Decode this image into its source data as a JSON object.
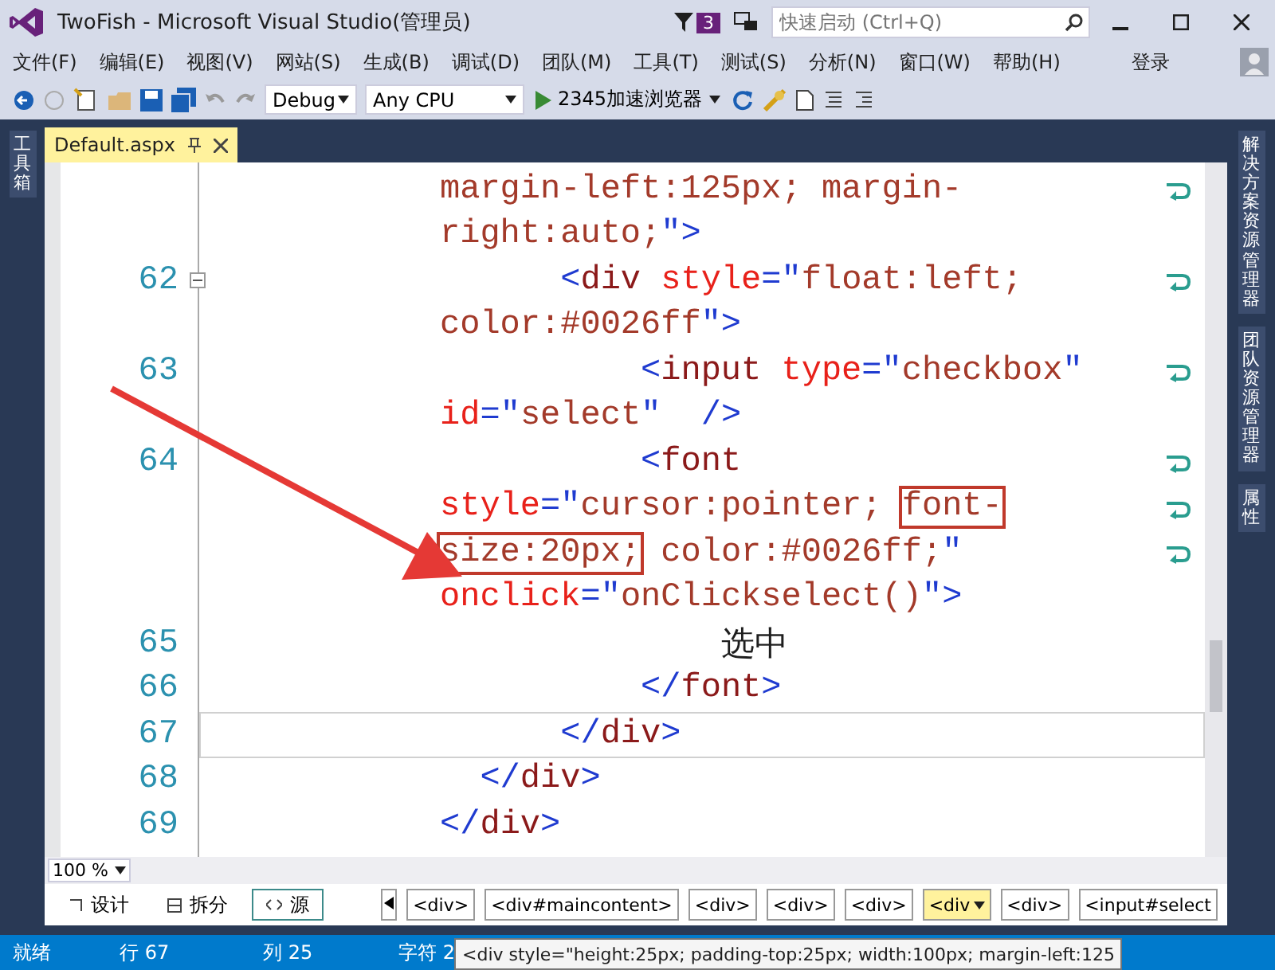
{
  "window": {
    "title": "TwoFish - Microsoft Visual Studio(管理员)",
    "notification_count": "3",
    "quick_launch": {
      "placeholder": "快速启动 (Ctrl+Q)"
    }
  },
  "menu": [
    "文件(F)",
    "编辑(E)",
    "视图(V)",
    "网站(S)",
    "生成(B)",
    "调试(D)",
    "团队(M)",
    "工具(T)",
    "测试(S)",
    "分析(N)",
    "窗口(W)",
    "帮助(H)"
  ],
  "sign_in": "登录",
  "toolbar": {
    "configuration": "Debug",
    "platform": "Any CPU",
    "run_target": "2345加速浏览器"
  },
  "left_panels": [
    "工具箱"
  ],
  "right_panels": [
    "解决方案资源管理器",
    "团队资源管理器",
    "属性"
  ],
  "document_tab": {
    "title": "Default.aspx",
    "selected": true
  },
  "code_lines": [
    {
      "segments": [
        {
          "kind": "value",
          "text": "margin-left:125px; margin-",
          "boxed": false
        }
      ],
      "wrapped": true,
      "current": false,
      "foldable": false
    },
    {
      "segments": [
        {
          "kind": "value",
          "text": "right:auto;",
          "boxed": false
        },
        {
          "kind": "punct",
          "text": "\">",
          "boxed": false
        }
      ],
      "wrapped": false,
      "current": false,
      "foldable": false
    },
    {
      "number": "62",
      "segments": [
        {
          "kind": "punct",
          "text": "      <",
          "boxed": false
        },
        {
          "kind": "tag",
          "text": "div",
          "boxed": false
        },
        {
          "kind": "attr",
          "text": " style",
          "boxed": false
        },
        {
          "kind": "punct",
          "text": "=\"",
          "boxed": false
        },
        {
          "kind": "value",
          "text": "float:left;",
          "boxed": false
        }
      ],
      "wrapped": true,
      "current": false,
      "foldable": true
    },
    {
      "segments": [
        {
          "kind": "value",
          "text": "color:#0026ff",
          "boxed": false
        },
        {
          "kind": "punct",
          "text": "\">",
          "boxed": false
        }
      ],
      "wrapped": false,
      "current": false,
      "foldable": false
    },
    {
      "number": "63",
      "segments": [
        {
          "kind": "punct",
          "text": "          <",
          "boxed": false
        },
        {
          "kind": "tag",
          "text": "input",
          "boxed": false
        },
        {
          "kind": "attr",
          "text": " type",
          "boxed": false
        },
        {
          "kind": "punct",
          "text": "=\"",
          "boxed": false
        },
        {
          "kind": "value",
          "text": "checkbox",
          "boxed": false
        },
        {
          "kind": "punct",
          "text": "\"",
          "boxed": false
        }
      ],
      "wrapped": true,
      "current": false,
      "foldable": false
    },
    {
      "segments": [
        {
          "kind": "attr",
          "text": "id",
          "boxed": false
        },
        {
          "kind": "punct",
          "text": "=\"",
          "boxed": false
        },
        {
          "kind": "value",
          "text": "select",
          "boxed": false
        },
        {
          "kind": "punct",
          "text": "\"  />",
          "boxed": false
        }
      ],
      "wrapped": false,
      "current": false,
      "foldable": false
    },
    {
      "number": "64",
      "segments": [
        {
          "kind": "punct",
          "text": "          <",
          "boxed": false
        },
        {
          "kind": "tag",
          "text": "font",
          "boxed": false
        }
      ],
      "wrapped": true,
      "current": false,
      "foldable": false
    },
    {
      "segments": [
        {
          "kind": "attr",
          "text": "style",
          "boxed": false
        },
        {
          "kind": "punct",
          "text": "=\"",
          "boxed": false
        },
        {
          "kind": "value",
          "text": "cursor:pointer; ",
          "boxed": false
        },
        {
          "kind": "value",
          "text": "font-",
          "boxed": true
        }
      ],
      "wrapped": true,
      "current": false,
      "foldable": false
    },
    {
      "segments": [
        {
          "kind": "value",
          "text": "size:20px;",
          "boxed": true
        },
        {
          "kind": "value",
          "text": " color:#0026ff;",
          "boxed": false
        },
        {
          "kind": "punct",
          "text": "\"",
          "boxed": false
        }
      ],
      "wrapped": true,
      "current": false,
      "foldable": false
    },
    {
      "segments": [
        {
          "kind": "attr",
          "text": "onclick",
          "boxed": false
        },
        {
          "kind": "punct",
          "text": "=\"",
          "boxed": false
        },
        {
          "kind": "value",
          "text": "onClickselect()",
          "boxed": false
        },
        {
          "kind": "punct",
          "text": "\">",
          "boxed": false
        }
      ],
      "wrapped": false,
      "current": false,
      "foldable": false
    },
    {
      "number": "65",
      "segments": [
        {
          "kind": "text",
          "text": "              选中",
          "boxed": false
        }
      ],
      "wrapped": false,
      "current": false,
      "foldable": false
    },
    {
      "number": "66",
      "segments": [
        {
          "kind": "punct",
          "text": "          </",
          "boxed": false
        },
        {
          "kind": "tag",
          "text": "font",
          "boxed": false
        },
        {
          "kind": "punct",
          "text": ">",
          "boxed": false
        }
      ],
      "wrapped": false,
      "current": false,
      "foldable": false
    },
    {
      "number": "67",
      "segments": [
        {
          "kind": "punct",
          "text": "      </",
          "boxed": false
        },
        {
          "kind": "tag",
          "text": "div",
          "boxed": false
        },
        {
          "kind": "punct",
          "text": ">",
          "boxed": false
        }
      ],
      "wrapped": false,
      "current": true,
      "foldable": false
    },
    {
      "number": "68",
      "segments": [
        {
          "kind": "punct",
          "text": "  </",
          "boxed": false
        },
        {
          "kind": "tag",
          "text": "div",
          "boxed": false
        },
        {
          "kind": "punct",
          "text": ">",
          "boxed": false
        }
      ],
      "wrapped": false,
      "current": false,
      "foldable": false
    },
    {
      "number": "69",
      "segments": [
        {
          "kind": "punct",
          "text": "</",
          "boxed": false
        },
        {
          "kind": "tag",
          "text": "div",
          "boxed": false
        },
        {
          "kind": "punct",
          "text": ">",
          "boxed": false
        }
      ],
      "wrapped": false,
      "current": false,
      "foldable": false
    }
  ],
  "zoom": "100 %",
  "view_buttons": [
    {
      "label": "设计",
      "kind": "design",
      "selected": false
    },
    {
      "label": "拆分",
      "kind": "split",
      "selected": false
    },
    {
      "label": "源",
      "kind": "source",
      "selected": true
    }
  ],
  "breadcrumbs": [
    {
      "label": "<div>",
      "selected": false
    },
    {
      "label": "<div#maincontent>",
      "selected": false
    },
    {
      "label": "<div>",
      "selected": false
    },
    {
      "label": "<div>",
      "selected": false
    },
    {
      "label": "<div>",
      "selected": false
    },
    {
      "label": "<div",
      "selected": true
    },
    {
      "label": "<div>",
      "selected": false
    },
    {
      "label": "<input#select",
      "selected": false
    }
  ],
  "status_bar": {
    "state": "就绪",
    "line": "行 67",
    "column": "列 25",
    "char": "字符 2"
  },
  "tooltip": "<div style=\"height:25px; padding-top:25px; width:100px; margin-left:125"
}
